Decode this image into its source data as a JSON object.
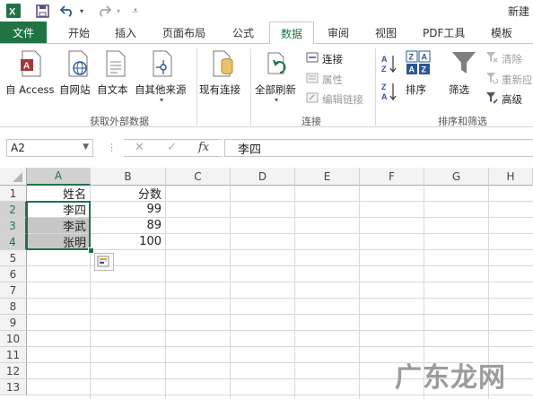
{
  "app_title": "新建",
  "quick_access": {
    "icons": [
      "excel-app-icon",
      "save-icon",
      "undo-icon",
      "redo-icon",
      "customize-icon"
    ]
  },
  "tabs": [
    {
      "label": "文件",
      "active": false
    },
    {
      "label": "开始",
      "active": false
    },
    {
      "label": "插入",
      "active": false
    },
    {
      "label": "页面布局",
      "active": false
    },
    {
      "label": "公式",
      "active": false
    },
    {
      "label": "数据",
      "active": true
    },
    {
      "label": "审阅",
      "active": false
    },
    {
      "label": "视图",
      "active": false
    },
    {
      "label": "PDF工具",
      "active": false
    },
    {
      "label": "模板",
      "active": false
    }
  ],
  "ribbon": {
    "get_external": {
      "group_label": "获取外部数据",
      "buttons": [
        "自 Access",
        "自网站",
        "自文本",
        "自其他来源"
      ]
    },
    "existing_connections": "现有连接",
    "connections": {
      "group_label": "连接",
      "refresh_all": "全部刷新",
      "connect": "连接",
      "properties": "属性",
      "edit_links": "编辑链接"
    },
    "sort_filter": {
      "group_label": "排序和筛选",
      "sort": "排序",
      "filter": "筛选",
      "clear": "清除",
      "reapply": "重新应",
      "advanced": "高级",
      "sort_az_top": "A",
      "sort_az_bottom": "Z",
      "sort_icon_z": "Z",
      "sort_icon_a": "A"
    }
  },
  "formula_bar": {
    "name_box": "A2",
    "cancel_symbol": "✕",
    "enter_symbol": "✓",
    "fx_symbol": "fx",
    "value": "李四"
  },
  "sheet": {
    "columns": [
      "A",
      "B",
      "C",
      "D",
      "E",
      "F",
      "G",
      "H"
    ],
    "rows": [
      "1",
      "2",
      "3",
      "4",
      "5",
      "6",
      "7",
      "8",
      "9",
      "10",
      "11",
      "12",
      "13"
    ],
    "selected_column": "A",
    "selected_rows": [
      "2",
      "3",
      "4"
    ],
    "cells": {
      "A1": "姓名",
      "B1": "分数",
      "A2": "李四",
      "B2": "99",
      "A3": "李武",
      "B3": "89",
      "A4": "张明",
      "B4": "100"
    }
  },
  "watermark": "广东龙网",
  "colors": {
    "accent": "#217346",
    "access_red": "#a4373a",
    "selection_gray": "#c6c6c6"
  }
}
